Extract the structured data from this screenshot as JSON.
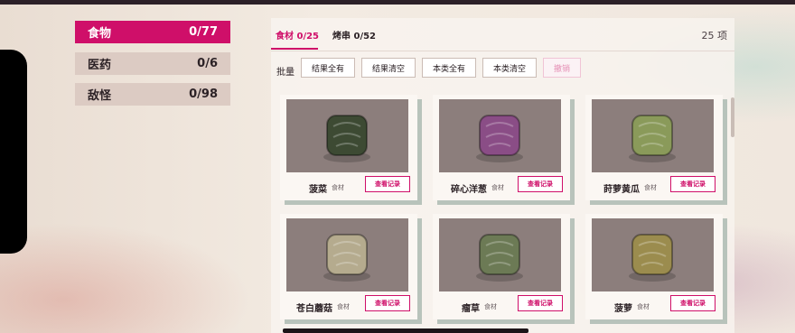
{
  "categories": [
    {
      "label": "食物",
      "count": "0/77",
      "active": true
    },
    {
      "label": "医药",
      "count": "0/6",
      "active": false
    },
    {
      "label": "敌怪",
      "count": "0/98",
      "active": false
    }
  ],
  "tabs": [
    {
      "label": "食材 0/25",
      "active": true
    },
    {
      "label": "烤串 0/52",
      "active": false
    }
  ],
  "item_count": "25 项",
  "toolbar": {
    "label": "批量",
    "buttons": [
      "结果全有",
      "结果清空",
      "本类全有",
      "本类清空",
      "撤销"
    ]
  },
  "items": [
    {
      "name": "菠菜",
      "type": "食材",
      "button": "查看记录",
      "icon": "spinach-icon",
      "color": "#3d4a33"
    },
    {
      "name": "碎心洋葱",
      "type": "食材",
      "button": "查看记录",
      "icon": "onion-icon",
      "color": "#8a4d86"
    },
    {
      "name": "莳萝黄瓜",
      "type": "食材",
      "button": "查看记录",
      "icon": "cucumber-icon",
      "color": "#8a9a5a"
    },
    {
      "name": "苍白蘑菇",
      "type": "食材",
      "button": "查看记录",
      "icon": "mushroom-icon",
      "color": "#b5ab8e"
    },
    {
      "name": "瘤草",
      "type": "食材",
      "button": "查看记录",
      "icon": "herb-icon",
      "color": "#6c7a55"
    },
    {
      "name": "菠萝",
      "type": "食材",
      "button": "查看记录",
      "icon": "pineapple-icon",
      "color": "#9b8c4e"
    }
  ],
  "colors": {
    "accent": "#cf0f69"
  }
}
